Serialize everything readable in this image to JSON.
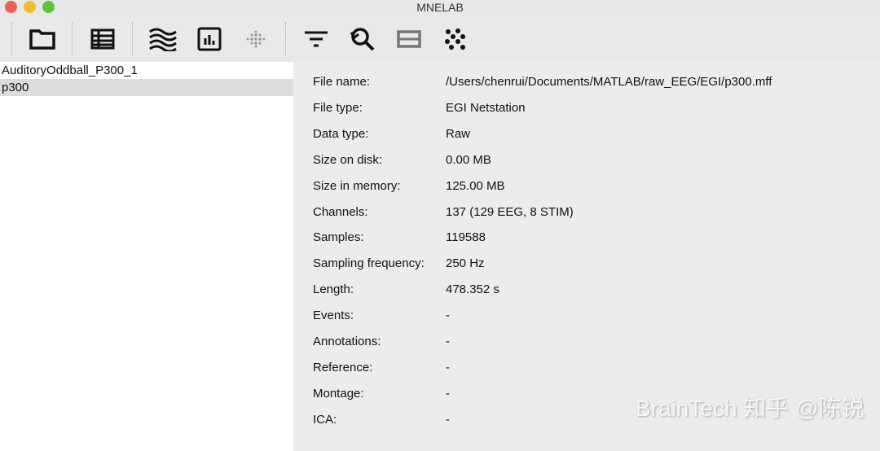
{
  "window": {
    "title": "MNELAB"
  },
  "toolbar": {
    "icons": [
      "open-folder-icon",
      "info-table-icon",
      "plot-data-icon",
      "psd-icon",
      "plot-montage-icon",
      "filter-icon",
      "find-events-icon",
      "pick-channels-icon",
      "ica-icon"
    ]
  },
  "datasets": [
    {
      "name": "AuditoryOddball_P300_1",
      "selected": false
    },
    {
      "name": "p300",
      "selected": true
    }
  ],
  "info": [
    {
      "key": "File name:",
      "value": "/Users/chenrui/Documents/MATLAB/raw_EEG/EGI/p300.mff"
    },
    {
      "key": "File type:",
      "value": "EGI Netstation"
    },
    {
      "key": "Data type:",
      "value": "Raw"
    },
    {
      "key": "Size on disk:",
      "value": "0.00 MB"
    },
    {
      "key": "Size in memory:",
      "value": "125.00 MB"
    },
    {
      "key": "Channels:",
      "value": "137 (129 EEG, 8 STIM)"
    },
    {
      "key": "Samples:",
      "value": "119588"
    },
    {
      "key": "Sampling frequency:",
      "value": "250 Hz"
    },
    {
      "key": "Length:",
      "value": "478.352 s"
    },
    {
      "key": "Events:",
      "value": "-"
    },
    {
      "key": "Annotations:",
      "value": "-"
    },
    {
      "key": "Reference:",
      "value": "-"
    },
    {
      "key": "Montage:",
      "value": "-"
    },
    {
      "key": "ICA:",
      "value": "-"
    }
  ],
  "watermark": "BrainTech 知乎 @陈锐"
}
